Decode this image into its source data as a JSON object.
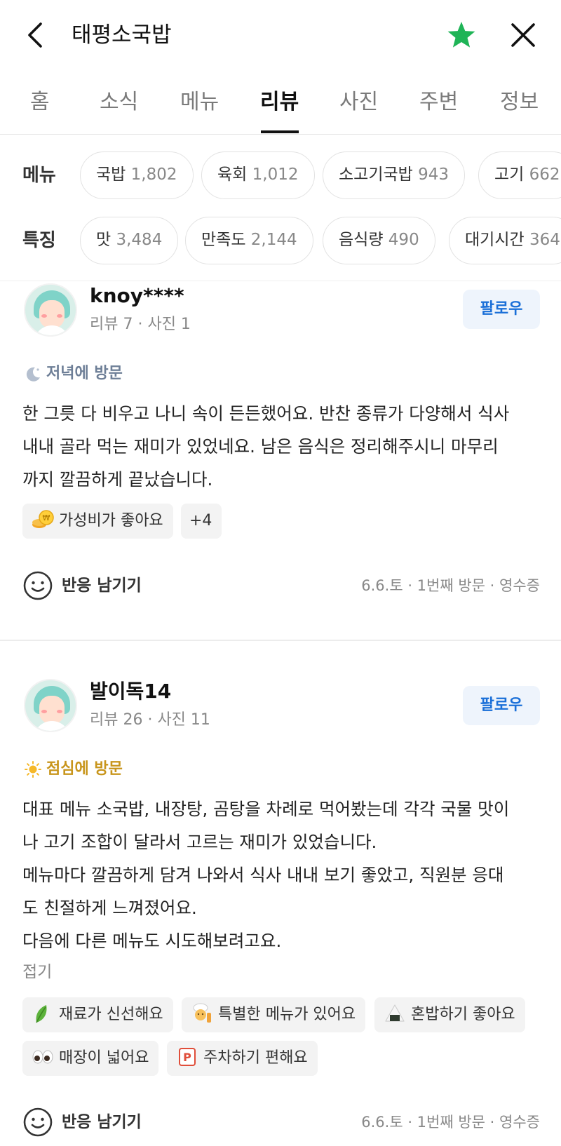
{
  "header": {
    "title": "태평소국밥",
    "icons": {
      "back": "chevron-left-icon",
      "favorite": "star-icon",
      "close": "close-icon"
    },
    "star_color": "#1fb457"
  },
  "tabs": [
    "홈",
    "소식",
    "메뉴",
    "리뷰",
    "사진",
    "주변",
    "정보"
  ],
  "active_tab": "리뷰",
  "filters": {
    "menu": {
      "label": "메뉴",
      "chips": [
        {
          "name": "국밥",
          "count": "1,802"
        },
        {
          "name": "육회",
          "count": "1,012"
        },
        {
          "name": "소고기국밥",
          "count": "943"
        },
        {
          "name": "고기",
          "count": "662"
        }
      ]
    },
    "features": {
      "label": "특징",
      "chips": [
        {
          "name": "맛",
          "count": "3,484"
        },
        {
          "name": "만족도",
          "count": "2,144"
        },
        {
          "name": "음식량",
          "count": "490"
        },
        {
          "name": "대기시간",
          "count": "364"
        }
      ]
    }
  },
  "reviews": [
    {
      "username": "knoy****",
      "stats": "리뷰 7 · 사진 1",
      "follow": "팔로우",
      "visit": "저녁에 방문",
      "visit_icon": "moon-icon",
      "visit_color": "#6e7f97",
      "lines": [
        "한 그릇 다 비우고 나니 속이 든든했어요. 반찬 종류가 다양해서 식사",
        "내내 골라 먹는 재미가 있었네요. 남은 음식은 정리해주시니 마무리",
        "까지 깔끔하게 끝났습니다."
      ],
      "tags": [
        {
          "text": "가성비가 좋아요",
          "icon": "coin-icon"
        },
        {
          "text": "+4",
          "icon": ""
        }
      ],
      "react": "반응 남기기",
      "meta": "6.6.토 · 1번째 방문 · 영수증"
    },
    {
      "username": "발이독14",
      "stats": "리뷰 26 · 사진 11",
      "follow": "팔로우",
      "visit": "점심에 방문",
      "visit_icon": "sun-icon",
      "visit_color": "#c8951b",
      "lines": [
        "대표 메뉴 소국밥, 내장탕, 곰탕을 차례로 먹어봤는데 각각 국물 맛이",
        "나 고기 조합이 달라서 고르는 재미가 있었습니다.",
        "메뉴마다 깔끔하게 담겨 나와서 식사 내내 보기 좋았고, 직원분 응대",
        "도 친절하게 느껴졌어요.",
        "다음에 다른 메뉴도 시도해보려고요."
      ],
      "fold": "접기",
      "tags": [
        {
          "text": "재료가 신선해요",
          "icon": "leaf-icon"
        },
        {
          "text": "특별한 메뉴가 있어요",
          "icon": "chef-icon"
        },
        {
          "text": "혼밥하기 좋아요",
          "icon": "rice-ball-icon"
        },
        {
          "text": "매장이 넓어요",
          "icon": "eyes-icon"
        },
        {
          "text": "주차하기 편해요",
          "icon": "parking-icon"
        }
      ],
      "react": "반응 남기기",
      "meta": "6.6.토 · 1번째 방문 · 영수증"
    }
  ]
}
